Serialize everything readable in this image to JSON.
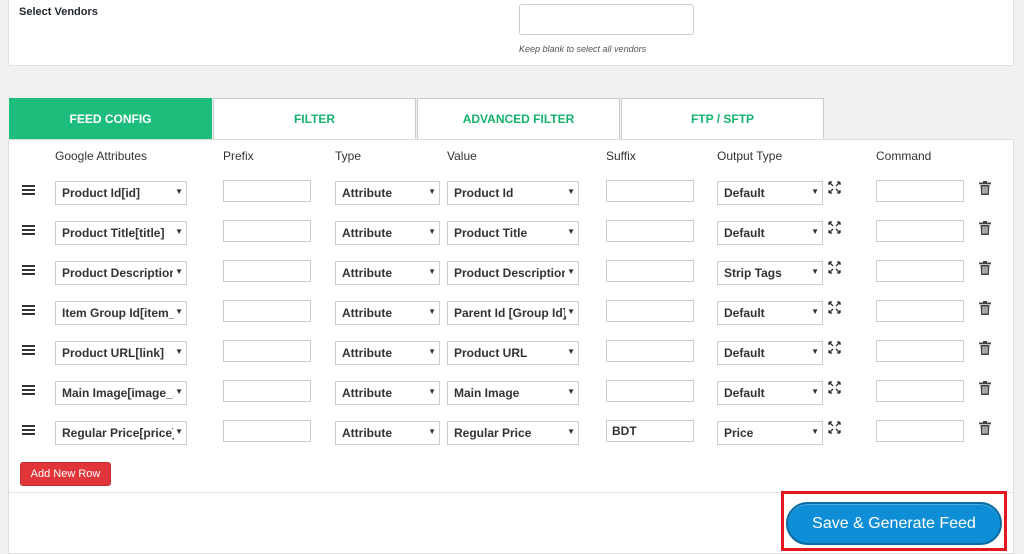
{
  "vendors": {
    "label": "Select Vendors",
    "input_value": "",
    "hint": "Keep blank to select all vendors"
  },
  "tabs": [
    {
      "label": "FEED CONFIG",
      "active": true
    },
    {
      "label": "FILTER",
      "active": false
    },
    {
      "label": "ADVANCED FILTER",
      "active": false
    },
    {
      "label": "FTP / SFTP",
      "active": false
    }
  ],
  "columns": {
    "attr": "Google Attributes",
    "prefix": "Prefix",
    "type": "Type",
    "value": "Value",
    "suffix": "Suffix",
    "output": "Output Type",
    "command": "Command"
  },
  "rows": [
    {
      "attr": "Product Id[id]",
      "prefix": "",
      "type": "Attribute",
      "value": "Product Id",
      "suffix": "",
      "output": "Default",
      "command": ""
    },
    {
      "attr": "Product Title[title]",
      "prefix": "",
      "type": "Attribute",
      "value": "Product Title",
      "suffix": "",
      "output": "Default",
      "command": ""
    },
    {
      "attr": "Product Description",
      "prefix": "",
      "type": "Attribute",
      "value": "Product Description",
      "suffix": "",
      "output": "Strip Tags",
      "command": ""
    },
    {
      "attr": "Item Group Id[item_group_id]",
      "prefix": "",
      "type": "Attribute",
      "value": "Parent Id [Group Id]",
      "suffix": "",
      "output": "Default",
      "command": ""
    },
    {
      "attr": "Product URL[link]",
      "prefix": "",
      "type": "Attribute",
      "value": "Product URL",
      "suffix": "",
      "output": "Default",
      "command": ""
    },
    {
      "attr": "Main Image[image_link]",
      "prefix": "",
      "type": "Attribute",
      "value": "Main Image",
      "suffix": "",
      "output": "Default",
      "command": ""
    },
    {
      "attr": "Regular Price[price]",
      "prefix": "",
      "type": "Attribute",
      "value": "Regular Price",
      "suffix": "BDT",
      "output": "Price",
      "command": ""
    }
  ],
  "buttons": {
    "add_row": "Add New Row",
    "save": "Save & Generate Feed"
  },
  "colors": {
    "accent_green": "#1dbd7c",
    "save_blue": "#0e8ed6",
    "add_red": "#e0363a",
    "highlight_red": "#e3171f"
  }
}
